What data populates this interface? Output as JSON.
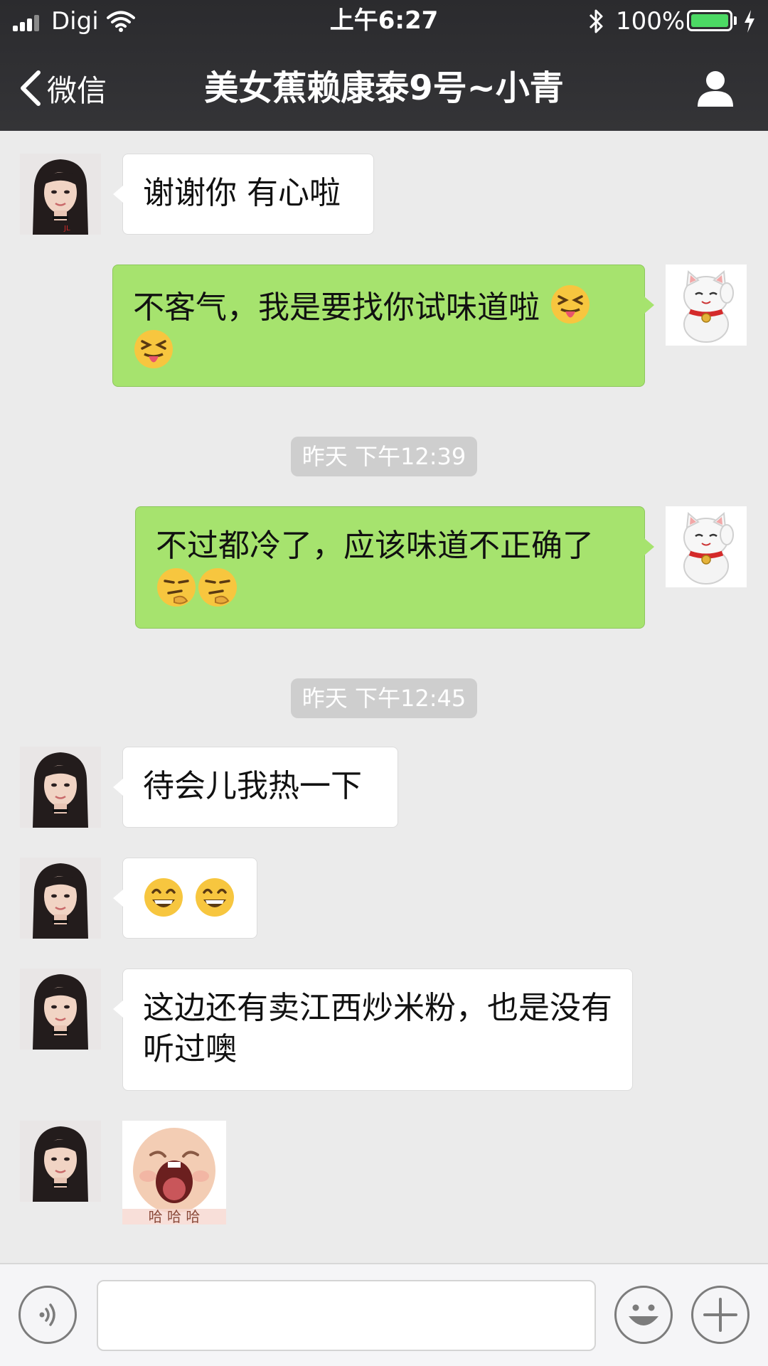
{
  "status_bar": {
    "carrier": "Digi",
    "time": "上午6:27",
    "battery_percent": "100%",
    "battery_level": 1.0
  },
  "nav": {
    "back_label": "微信",
    "title": "美女蕉赖康泰9号~小青"
  },
  "messages": [
    {
      "side": "left",
      "type": "text",
      "text": "谢谢你 有心啦"
    },
    {
      "side": "right",
      "type": "text",
      "text": "不客气，我是要找你试味道啦",
      "emoji": [
        "squinting-tongue-emoji",
        "squinting-tongue-emoji"
      ]
    },
    {
      "type": "timestamp",
      "text": "昨天 下午12:39"
    },
    {
      "side": "right",
      "type": "text",
      "text": "不过都冷了，应该味道不正确了",
      "emoji": [
        "thinking-emoji",
        "thinking-emoji"
      ]
    },
    {
      "type": "timestamp",
      "text": "昨天 下午12:45"
    },
    {
      "side": "left",
      "type": "text",
      "text": "待会儿我热一下"
    },
    {
      "side": "left",
      "type": "emoji-only",
      "emoji": [
        "grinning-emoji",
        "grinning-emoji"
      ]
    },
    {
      "side": "left",
      "type": "text",
      "text": "这边还有卖江西炒米粉，也是没有听过噢"
    },
    {
      "side": "left",
      "type": "sticker",
      "sticker": "laughing-baby-sticker",
      "caption": "哈 哈 哈"
    }
  ],
  "input": {
    "placeholder": "",
    "value": ""
  },
  "colors": {
    "nav_bg": "#2e2e31",
    "chat_bg": "#ebebeb",
    "outgoing_bubble": "#a6e36e",
    "incoming_bubble": "#ffffff",
    "timestamp_bg": "#cecece"
  }
}
